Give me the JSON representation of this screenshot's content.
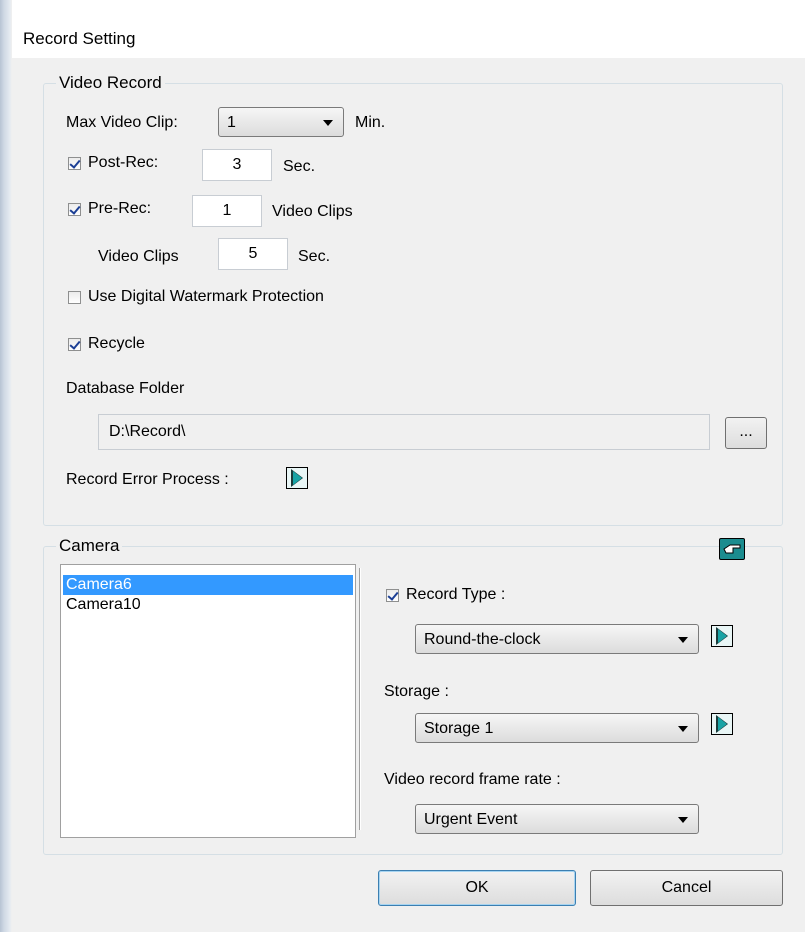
{
  "window": {
    "title": "Record Setting"
  },
  "video_record": {
    "group_label": "Video Record",
    "max_video_clip": {
      "label": "Max Video Clip:",
      "value": "1",
      "unit": "Min."
    },
    "post_rec": {
      "label": "Post-Rec:",
      "checked": true,
      "value": "3",
      "unit": "Sec."
    },
    "pre_rec": {
      "label": "Pre-Rec:",
      "checked": true,
      "value": "1",
      "unit": "Video Clips"
    },
    "video_clips": {
      "label": "Video Clips",
      "value": "5",
      "unit": "Sec."
    },
    "watermark": {
      "label": "Use Digital Watermark Protection",
      "checked": false
    },
    "recycle": {
      "label": "Recycle",
      "checked": true
    },
    "database_folder": {
      "label": "Database Folder",
      "value": "D:\\Record\\",
      "browse_label": "..."
    },
    "record_error_process": {
      "label": "Record Error Process :"
    }
  },
  "camera": {
    "group_label": "Camera",
    "list": [
      "Camera6",
      "Camera10"
    ],
    "selected_index": 0,
    "record_type": {
      "label": "Record Type :",
      "checked": true,
      "value": "Round-the-clock"
    },
    "storage": {
      "label": "Storage :",
      "value": "Storage 1"
    },
    "frame_rate": {
      "label": "Video record frame rate :",
      "value": "Urgent Event"
    },
    "icon": "pointing-hand-icon"
  },
  "buttons": {
    "ok": "OK",
    "cancel": "Cancel"
  }
}
